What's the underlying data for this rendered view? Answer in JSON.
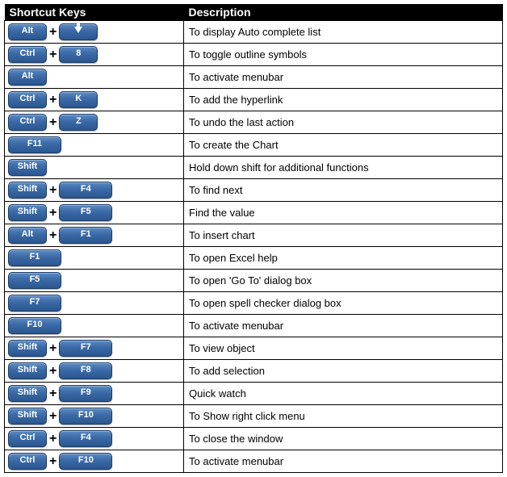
{
  "headers": {
    "keys": "Shortcut Keys",
    "desc": "Description"
  },
  "plus": "+",
  "rows": [
    {
      "keys": [
        {
          "label": "Alt"
        },
        {
          "icon": "arrow-down"
        }
      ],
      "desc": "To display Auto complete list"
    },
    {
      "keys": [
        {
          "label": "Ctrl"
        },
        {
          "label": "8"
        }
      ],
      "desc": "To toggle outline symbols"
    },
    {
      "keys": [
        {
          "label": "Alt"
        }
      ],
      "desc": "To activate menubar"
    },
    {
      "keys": [
        {
          "label": "Ctrl"
        },
        {
          "label": "K"
        }
      ],
      "desc": "To add the hyperlink"
    },
    {
      "keys": [
        {
          "label": "Ctrl"
        },
        {
          "label": "Z"
        }
      ],
      "desc": "To undo the last action"
    },
    {
      "keys": [
        {
          "label": "F11",
          "wide": true
        }
      ],
      "desc": "To create the Chart"
    },
    {
      "keys": [
        {
          "label": "Shift"
        }
      ],
      "desc": "Hold down shift for additional functions"
    },
    {
      "keys": [
        {
          "label": "Shift"
        },
        {
          "label": "F4",
          "wide": true
        }
      ],
      "desc": "To find next"
    },
    {
      "keys": [
        {
          "label": "Shift"
        },
        {
          "label": "F5",
          "wide": true
        }
      ],
      "desc": "Find the value"
    },
    {
      "keys": [
        {
          "label": "Alt"
        },
        {
          "label": "F1",
          "wide": true
        }
      ],
      "desc": "To insert chart"
    },
    {
      "keys": [
        {
          "label": "F1",
          "wide": true
        }
      ],
      "desc": "To open Excel help"
    },
    {
      "keys": [
        {
          "label": "F5",
          "wide": true
        }
      ],
      "desc": "To open 'Go To' dialog box"
    },
    {
      "keys": [
        {
          "label": "F7",
          "wide": true
        }
      ],
      "desc": "To open spell checker dialog box"
    },
    {
      "keys": [
        {
          "label": "F10",
          "wide": true
        }
      ],
      "desc": "To activate menubar"
    },
    {
      "keys": [
        {
          "label": "Shift"
        },
        {
          "label": "F7",
          "wide": true
        }
      ],
      "desc": "To view object"
    },
    {
      "keys": [
        {
          "label": "Shift"
        },
        {
          "label": "F8",
          "wide": true
        }
      ],
      "desc": "To add selection"
    },
    {
      "keys": [
        {
          "label": "Shift"
        },
        {
          "label": "F9",
          "wide": true
        }
      ],
      "desc": "Quick watch"
    },
    {
      "keys": [
        {
          "label": "Shift"
        },
        {
          "label": "F10",
          "wide": true
        }
      ],
      "desc": "To Show right click menu"
    },
    {
      "keys": [
        {
          "label": "Ctrl"
        },
        {
          "label": "F4",
          "wide": true
        }
      ],
      "desc": "To close the window"
    },
    {
      "keys": [
        {
          "label": "Ctrl"
        },
        {
          "label": "F10",
          "wide": true
        }
      ],
      "desc": "To activate menubar"
    }
  ]
}
